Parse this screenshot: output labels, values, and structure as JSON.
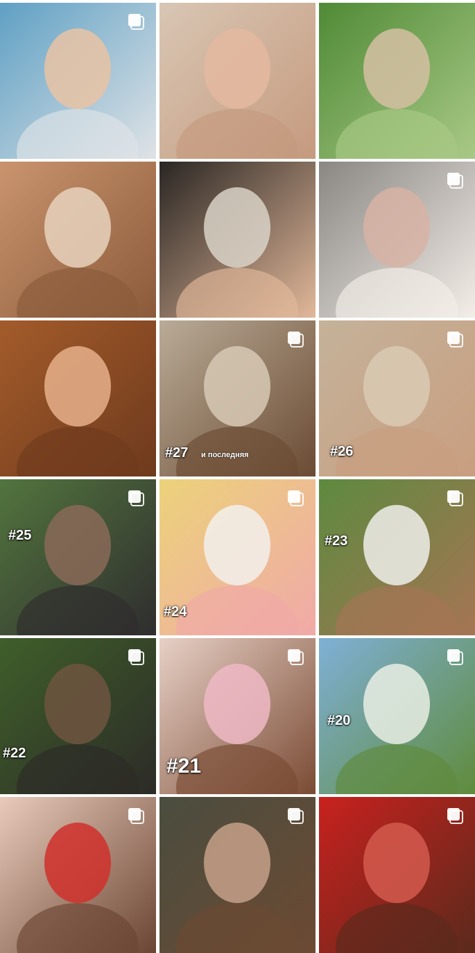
{
  "feed": {
    "rows": [
      [
        {
          "colors": [
            "#5fa0c4",
            "#e9c3a5",
            "#dfe3e6"
          ],
          "multi": true,
          "caption": "",
          "subcaption": "",
          "icon": "child-portrait"
        },
        {
          "colors": [
            "#d8c6b4",
            "#e4b8a0",
            "#c59a7e"
          ],
          "multi": false,
          "caption": "",
          "subcaption": "",
          "icon": "woman-selfie"
        },
        {
          "colors": [
            "#4f8a36",
            "#d5c0a2",
            "#a9c986"
          ],
          "multi": false,
          "caption": "",
          "subcaption": "",
          "icon": "woman-in-field"
        }
      ],
      [
        {
          "colors": [
            "#c9946e",
            "#e7d2bd",
            "#8b5a3a"
          ],
          "multi": false,
          "caption": "",
          "subcaption": "",
          "icon": "closeup-face"
        },
        {
          "colors": [
            "#2a2623",
            "#d9d2c7",
            "#e2b89a"
          ],
          "multi": false,
          "caption": "",
          "subcaption": "",
          "icon": "woman-black-dress"
        },
        {
          "colors": [
            "#8a8682",
            "#d7b3a4",
            "#f3eee8"
          ],
          "multi": true,
          "caption": "",
          "subcaption": "",
          "icon": "woman-on-sofa"
        }
      ],
      [
        {
          "colors": [
            "#a35b2a",
            "#e6b08b",
            "#6e3a1d"
          ],
          "multi": false,
          "caption": "",
          "subcaption": "",
          "icon": "smiling-woman-closeup"
        },
        {
          "colors": [
            "#b9ab97",
            "#d7c9b5",
            "#6b4b33"
          ],
          "multi": true,
          "caption": "#27",
          "subcaption": "и последняя",
          "icon": "woman-lying-sand"
        },
        {
          "colors": [
            "#c4b299",
            "#d9cab4",
            "#c99e80"
          ],
          "multi": true,
          "caption": "#26",
          "subcaption": "",
          "icon": "woman-lying-sand"
        }
      ],
      [
        {
          "colors": [
            "#52753e",
            "#8a6a58",
            "#2f2d2e"
          ],
          "multi": true,
          "caption": "#25",
          "subcaption": "",
          "icon": "woman-with-child"
        },
        {
          "colors": [
            "#ecd27a",
            "#f2f0ec",
            "#f0a9a8"
          ],
          "multi": true,
          "caption": "#24",
          "subcaption": "",
          "icon": "woman-yellow-wall"
        },
        {
          "colors": [
            "#5d8a3f",
            "#efeeea",
            "#a67454"
          ],
          "multi": true,
          "caption": "#23",
          "subcaption": "",
          "icon": "woman-lilac-flowers"
        }
      ],
      [
        {
          "colors": [
            "#3f5f2a",
            "#6f5540",
            "#2c2b27"
          ],
          "multi": true,
          "caption": "#22",
          "subcaption": "",
          "icon": "woman-by-tree"
        },
        {
          "colors": [
            "#e7d0c6",
            "#efb9c6",
            "#7a4b34"
          ],
          "multi": true,
          "caption": "#21",
          "subcaption": "",
          "icon": "woman-pink-flowers"
        },
        {
          "colors": [
            "#7fb0d6",
            "#e9ede4",
            "#5f8b3c"
          ],
          "multi": true,
          "caption": "#20",
          "subcaption": "",
          "icon": "woman-on-grass"
        }
      ],
      [
        {
          "colors": [
            "#e9cbbb",
            "#d0302c",
            "#6b4533"
          ],
          "multi": true,
          "caption": "",
          "subcaption": "",
          "icon": "woman-red-lips"
        },
        {
          "colors": [
            "#4a4d3f",
            "#c6a08a",
            "#6c4a33"
          ],
          "multi": true,
          "caption": "",
          "subcaption": "",
          "icon": "woman-portrait"
        },
        {
          "colors": [
            "#c9211e",
            "#d45a4d",
            "#5a2a1c"
          ],
          "multi": true,
          "caption": "",
          "subcaption": "",
          "icon": "woman-red-background"
        }
      ]
    ]
  }
}
